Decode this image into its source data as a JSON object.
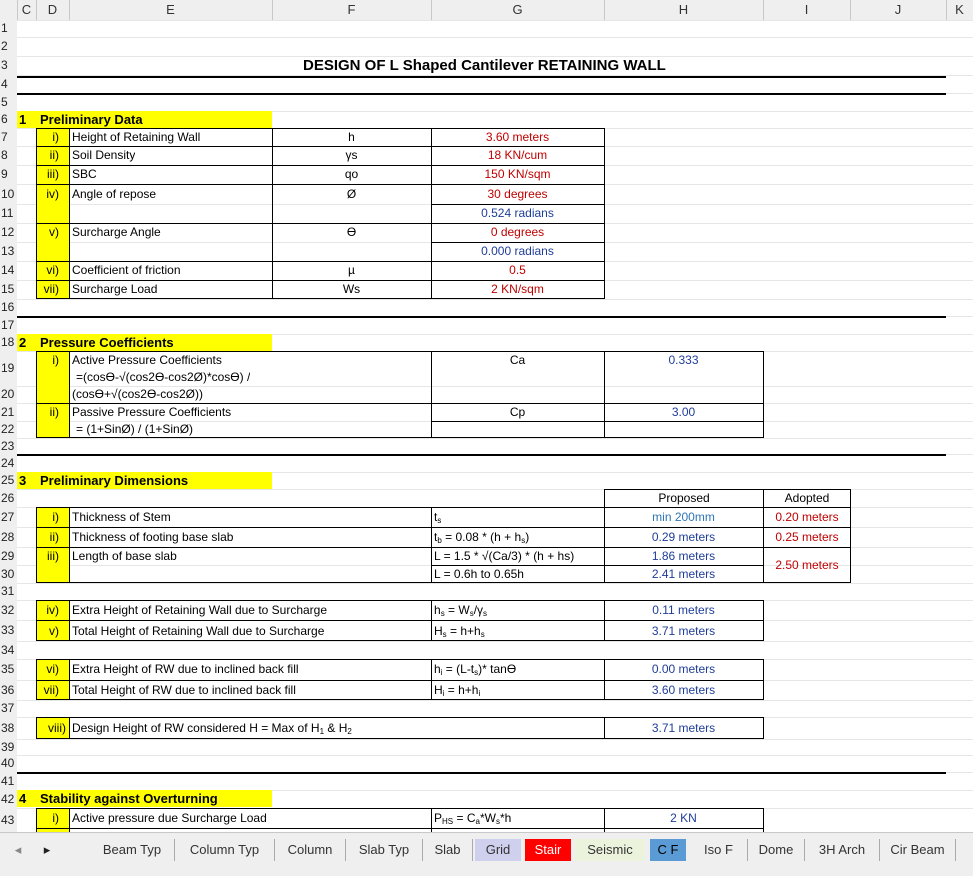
{
  "columns": [
    "C",
    "D",
    "E",
    "F",
    "G",
    "H",
    "I",
    "J",
    "K"
  ],
  "rows": [
    "1",
    "2",
    "3",
    "4",
    "5",
    "6",
    "7",
    "8",
    "9",
    "10",
    "11",
    "12",
    "13",
    "14",
    "15",
    "16",
    "17",
    "18",
    "19",
    "20",
    "21",
    "22",
    "23",
    "24",
    "25",
    "26",
    "27",
    "28",
    "29",
    "30",
    "31",
    "32",
    "33",
    "34",
    "35",
    "36",
    "37",
    "38",
    "39",
    "40",
    "41",
    "42",
    "43"
  ],
  "title": "DESIGN OF L Shaped Cantilever RETAINING WALL",
  "s1": {
    "num": "1",
    "name": "Preliminary Data",
    "items": [
      {
        "idx": "i)",
        "label": "Height of Retaining Wall",
        "sym": "h",
        "val": "3.60 meters"
      },
      {
        "idx": "ii)",
        "label": "Soil Density",
        "sym": "γs",
        "val": "18 KN/cum"
      },
      {
        "idx": "iii)",
        "label": "SBC",
        "sym": "qo",
        "val": "150 KN/sqm"
      },
      {
        "idx": "iv)",
        "label": "Angle of repose",
        "sym": "Ø",
        "val": "30 degrees",
        "val2": "0.524 radians"
      },
      {
        "idx": "v)",
        "label": "Surcharge Angle",
        "sym": "ϴ",
        "val": "0 degrees",
        "val2": "0.000 radians"
      },
      {
        "idx": "vi)",
        "label": "Coefficient of friction",
        "sym": "µ",
        "val": "0.5"
      },
      {
        "idx": "vii)",
        "label": "Surcharge Load",
        "sym": "Ws",
        "val": "2 KN/sqm"
      }
    ]
  },
  "s2": {
    "num": "2",
    "name": "Pressure Coefficients",
    "a_idx": "i)",
    "a_label": "Active Pressure Coefficients",
    "a_f1": "=(cosϴ-√(cos2ϴ-cos2Ø)*cosϴ) /",
    "a_f2": "(cosϴ+√(cos2ϴ-cos2Ø))",
    "a_sym": "Ca",
    "a_val": "0.333",
    "p_idx": "ii)",
    "p_label": "Passive Pressure Coefficients",
    "p_f1": "= (1+SinØ) / (1+SinØ)",
    "p_sym": "Cp",
    "p_val": "3.00"
  },
  "s3": {
    "num": "3",
    "name": "Preliminary Dimensions",
    "proposed": "Proposed",
    "adopted": "Adopted",
    "r1_idx": "i)",
    "r1_label": "Thickness of Stem",
    "r1_prop": "min 200mm",
    "r1_adopt": "0.20 meters",
    "r2_idx": "ii)",
    "r2_label": "Thickness of footing base slab",
    "r2_prop": "0.29 meters",
    "r2_adopt": "0.25 meters",
    "r3_idx": "iii)",
    "r3_label": "Length of base slab",
    "r3_prop1": "1.86 meters",
    "r3_prop2": "2.41 meters",
    "r3_adopt": "2.50 meters",
    "r4_idx": "iv)",
    "r4_label": "Extra Height of Retaining Wall due to Surcharge",
    "r4_prop": "0.11 meters",
    "r5_idx": "v)",
    "r5_label": "Total Height of Retaining Wall due to Surcharge",
    "r5_prop": "3.71 meters",
    "r6_idx": "vi)",
    "r6_label": "Extra Height of RW due to inclined back fill",
    "r6_prop": "0.00 meters",
    "r7_idx": "vii)",
    "r7_label": "Total Height of RW due to inclined back fill",
    "r7_prop": "3.60 meters",
    "r8_idx": "viii)",
    "r8_prop": "3.71 meters"
  },
  "s4": {
    "num": "4",
    "name": "Stability against Overturning",
    "r1_idx": "i)",
    "r1_label": "Active pressure due Surcharge Load",
    "r1_val": "2 KN"
  },
  "tabs": [
    "Beam Typ",
    "Column Typ",
    "Column",
    "Slab Typ",
    "Slab",
    "Grid",
    "Stair",
    "Seismic",
    "C F",
    "Iso F",
    "Dome",
    "3H Arch",
    "Cir Beam"
  ]
}
